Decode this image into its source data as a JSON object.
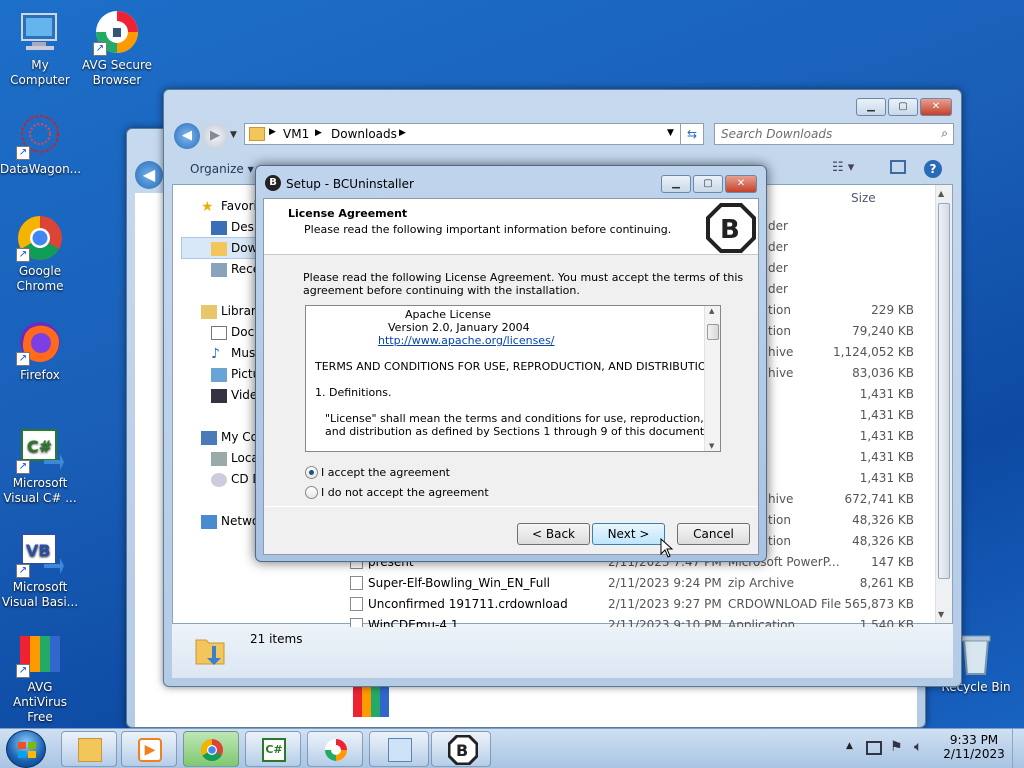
{
  "desktop": {
    "icons": [
      {
        "label": "My Computer"
      },
      {
        "label": "AVG Secure Browser"
      },
      {
        "label": "DataWagon..."
      },
      {
        "label": "Google Chrome"
      },
      {
        "label": "Firefox"
      },
      {
        "label": "Microsoft Visual C# ..."
      },
      {
        "label": "Microsoft Visual Basi..."
      },
      {
        "label": "AVG AntiVirus Free"
      },
      {
        "label": "Recycle Bin"
      }
    ]
  },
  "explorer": {
    "breadcrumb": [
      "VM1",
      "Downloads"
    ],
    "search_placeholder": "Search Downloads",
    "toolbar": {
      "organize": "Organize"
    },
    "column_size": "Size",
    "nav": [
      {
        "label": "Favorites"
      },
      {
        "label": "Desktop"
      },
      {
        "label": "Downloads"
      },
      {
        "label": "Recent Places"
      },
      {
        "label": "Libraries"
      },
      {
        "label": "Documents"
      },
      {
        "label": "Music"
      },
      {
        "label": "Pictures"
      },
      {
        "label": "Videos"
      },
      {
        "label": "My Computer"
      },
      {
        "label": "Local Disk"
      },
      {
        "label": "CD Drive"
      },
      {
        "label": "Network"
      }
    ],
    "rows_partial": [
      {
        "type": "der",
        "size": ""
      },
      {
        "type": "der",
        "size": ""
      },
      {
        "type": "der",
        "size": ""
      },
      {
        "type": "der",
        "size": ""
      },
      {
        "type": "tion",
        "size": "229 KB"
      },
      {
        "type": "tion",
        "size": "79,240 KB"
      },
      {
        "type": "hive",
        "size": "1,124,052 KB"
      },
      {
        "type": "hive",
        "size": "83,036 KB"
      },
      {
        "type": "",
        "size": "1,431 KB"
      },
      {
        "type": "",
        "size": "1,431 KB"
      },
      {
        "type": "",
        "size": "1,431 KB"
      },
      {
        "type": "",
        "size": "1,431 KB"
      },
      {
        "type": "",
        "size": "1,431 KB"
      },
      {
        "type": "hive",
        "size": "672,741 KB"
      },
      {
        "type": "tion",
        "size": "48,326 KB"
      },
      {
        "type": "tion",
        "size": "48,326 KB"
      }
    ],
    "rows_full": [
      {
        "name": "present",
        "date": "2/11/2023 7:47 PM",
        "type": "Microsoft PowerP...",
        "size": "147 KB"
      },
      {
        "name": "Super-Elf-Bowling_Win_EN_Full",
        "date": "2/11/2023 9:24 PM",
        "type": "zip Archive",
        "size": "8,261 KB"
      },
      {
        "name": "Unconfirmed 191711.crdownload",
        "date": "2/11/2023 9:27 PM",
        "type": "CRDOWNLOAD File",
        "size": "565,873 KB"
      },
      {
        "name": "WinCDEmu-4.1",
        "date": "2/11/2023 9:10 PM",
        "type": "Application",
        "size": "1,540 KB"
      }
    ],
    "status": "21 items"
  },
  "dialog": {
    "title": "Setup - BCUninstaller",
    "heading": "License Agreement",
    "subheading": "Please read the following important information before continuing.",
    "instruction_1": "Please read the following License Agreement. You must accept the terms of this",
    "instruction_2": "agreement before continuing with the installation.",
    "license": {
      "line1": "Apache License",
      "line2": "Version 2.0, January 2004",
      "link": "http://www.apache.org/licenses/",
      "terms": "TERMS AND CONDITIONS FOR USE, REPRODUCTION, AND DISTRIBUTION",
      "defs": "1. Definitions.",
      "def1a": "\"License\" shall mean the terms and conditions for use, reproduction,",
      "def1b": "and distribution as defined by Sections 1 through 9 of this document."
    },
    "accept": "I accept the agreement",
    "decline": "I do not accept the agreement",
    "back": "< Back",
    "next": "Next >",
    "cancel": "Cancel"
  },
  "taskbar": {
    "time": "9:33 PM",
    "date": "2/11/2023"
  }
}
